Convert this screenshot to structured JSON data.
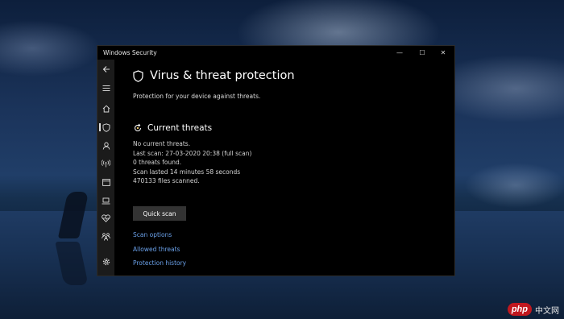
{
  "window": {
    "title": "Windows Security",
    "controls": {
      "minimize": "—",
      "maximize": "☐",
      "close": "✕"
    }
  },
  "sidebar": {
    "items": [
      {
        "name": "back",
        "icon": "arrow-left-icon"
      },
      {
        "name": "menu",
        "icon": "hamburger-menu-icon"
      },
      {
        "name": "home",
        "icon": "home-icon"
      },
      {
        "name": "virus-threat-protection",
        "icon": "shield-icon",
        "active": true
      },
      {
        "name": "account-protection",
        "icon": "person-icon"
      },
      {
        "name": "firewall-network",
        "icon": "wifi-antenna-icon"
      },
      {
        "name": "app-browser-control",
        "icon": "app-window-icon"
      },
      {
        "name": "device-security",
        "icon": "laptop-icon"
      },
      {
        "name": "device-performance-health",
        "icon": "heart-icon"
      },
      {
        "name": "family-options",
        "icon": "family-icon"
      },
      {
        "name": "settings",
        "icon": "gear-icon"
      }
    ]
  },
  "main": {
    "title": "Virus & threat protection",
    "subtitle": "Protection for your device against threats.",
    "current_threats": {
      "heading": "Current threats",
      "lines": [
        "No current threats.",
        "Last scan: 27-03-2020 20:38 (full scan)",
        "0 threats found.",
        "Scan lasted 14 minutes 58 seconds",
        "470133 files scanned."
      ],
      "quick_scan_label": "Quick scan"
    },
    "links": {
      "scan_options": "Scan options",
      "allowed_threats": "Allowed threats",
      "protection_history": "Protection history"
    }
  },
  "watermark": {
    "logo": "php",
    "text": "中文网"
  },
  "colors": {
    "link": "#6aa0e8",
    "window_bg": "#000000",
    "sidebar_bg": "#1b1b1b",
    "button_bg": "#333333"
  }
}
